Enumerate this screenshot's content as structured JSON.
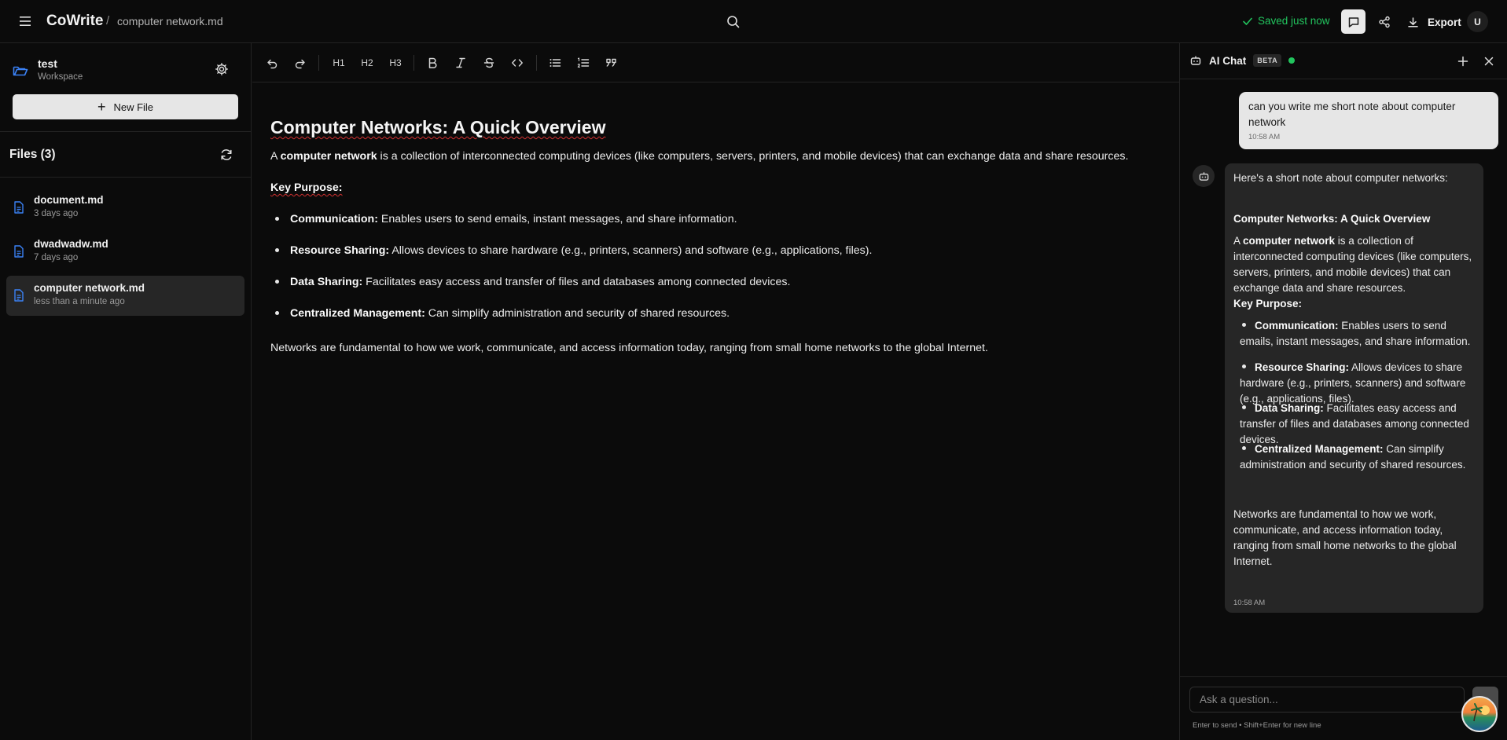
{
  "header": {
    "brand": "CoWrite",
    "separator": "/",
    "current_file": "computer network.md",
    "saved_status": "Saved just now",
    "export_label": "Export",
    "user_initial": "U"
  },
  "sidebar": {
    "workspace_name": "test",
    "workspace_label": "Workspace",
    "new_file_label": "New File",
    "files_title": "Files (3)",
    "files": [
      {
        "name": "document.md",
        "time": "3 days ago"
      },
      {
        "name": "dwadwadw.md",
        "time": "7 days ago"
      },
      {
        "name": "computer network.md",
        "time": "less than a minute ago"
      }
    ]
  },
  "toolbar": {
    "h1": "H1",
    "h2": "H2",
    "h3": "H3"
  },
  "editor": {
    "title": "Computer Networks: A Quick Overview",
    "intro_pre": "A ",
    "intro_bold": "computer network",
    "intro_post": " is a collection of interconnected computing devices (like computers, servers, printers, and mobile devices) that can exchange data and share resources.",
    "key_purpose": "Key Purpose:",
    "items": [
      {
        "term": "Communication:",
        "text": " Enables users to send emails, instant messages, and share information."
      },
      {
        "term": "Resource Sharing:",
        "text": " Allows devices to share hardware (e.g., printers, scanners) and software (e.g., applications, files)."
      },
      {
        "term": "Data Sharing:",
        "text": " Facilitates easy access and transfer of files and databases among connected devices."
      },
      {
        "term": "Centralized Management:",
        "text": " Can simplify administration and security of shared resources."
      }
    ],
    "closing": "Networks are fundamental to how we work, communicate, and access information today, ranging from small home networks to the global Internet."
  },
  "chat": {
    "title": "AI Chat",
    "badge": "BETA",
    "user_message": "can you write me short note about computer network",
    "user_time": "10:58 AM",
    "bot_intro": "Here's a short note about computer networks:",
    "bot_heading": "Computer Networks: A Quick Overview",
    "bot_p_pre": "A ",
    "bot_p_bold": "computer network",
    "bot_p_post": " is a collection of interconnected computing devices (like computers, servers, printers, and mobile devices) that can exchange data and share resources.",
    "bot_key": "Key Purpose:",
    "bot_items": [
      {
        "term": "Communication:",
        "text": " Enables users to send emails, instant messages, and share information."
      },
      {
        "term": "Resource Sharing:",
        "text": " Allows devices to share hardware (e.g., printers, scanners) and software (e.g., applications, files)."
      },
      {
        "term": "Data Sharing:",
        "text": " Facilitates easy access and transfer of files and databases among connected devices."
      },
      {
        "term": "Centralized Management:",
        "text": " Can simplify administration and security of shared resources."
      }
    ],
    "bot_closing": "Networks are fundamental to how we work, communicate, and access information today, ranging from small home networks to the global Internet.",
    "bot_time": "10:58 AM",
    "input_placeholder": "Ask a question...",
    "hint": "Enter to send • Shift+Enter for new line"
  },
  "colors": {
    "accent_green": "#22c55e",
    "file_icon_blue": "#3b82f6"
  }
}
